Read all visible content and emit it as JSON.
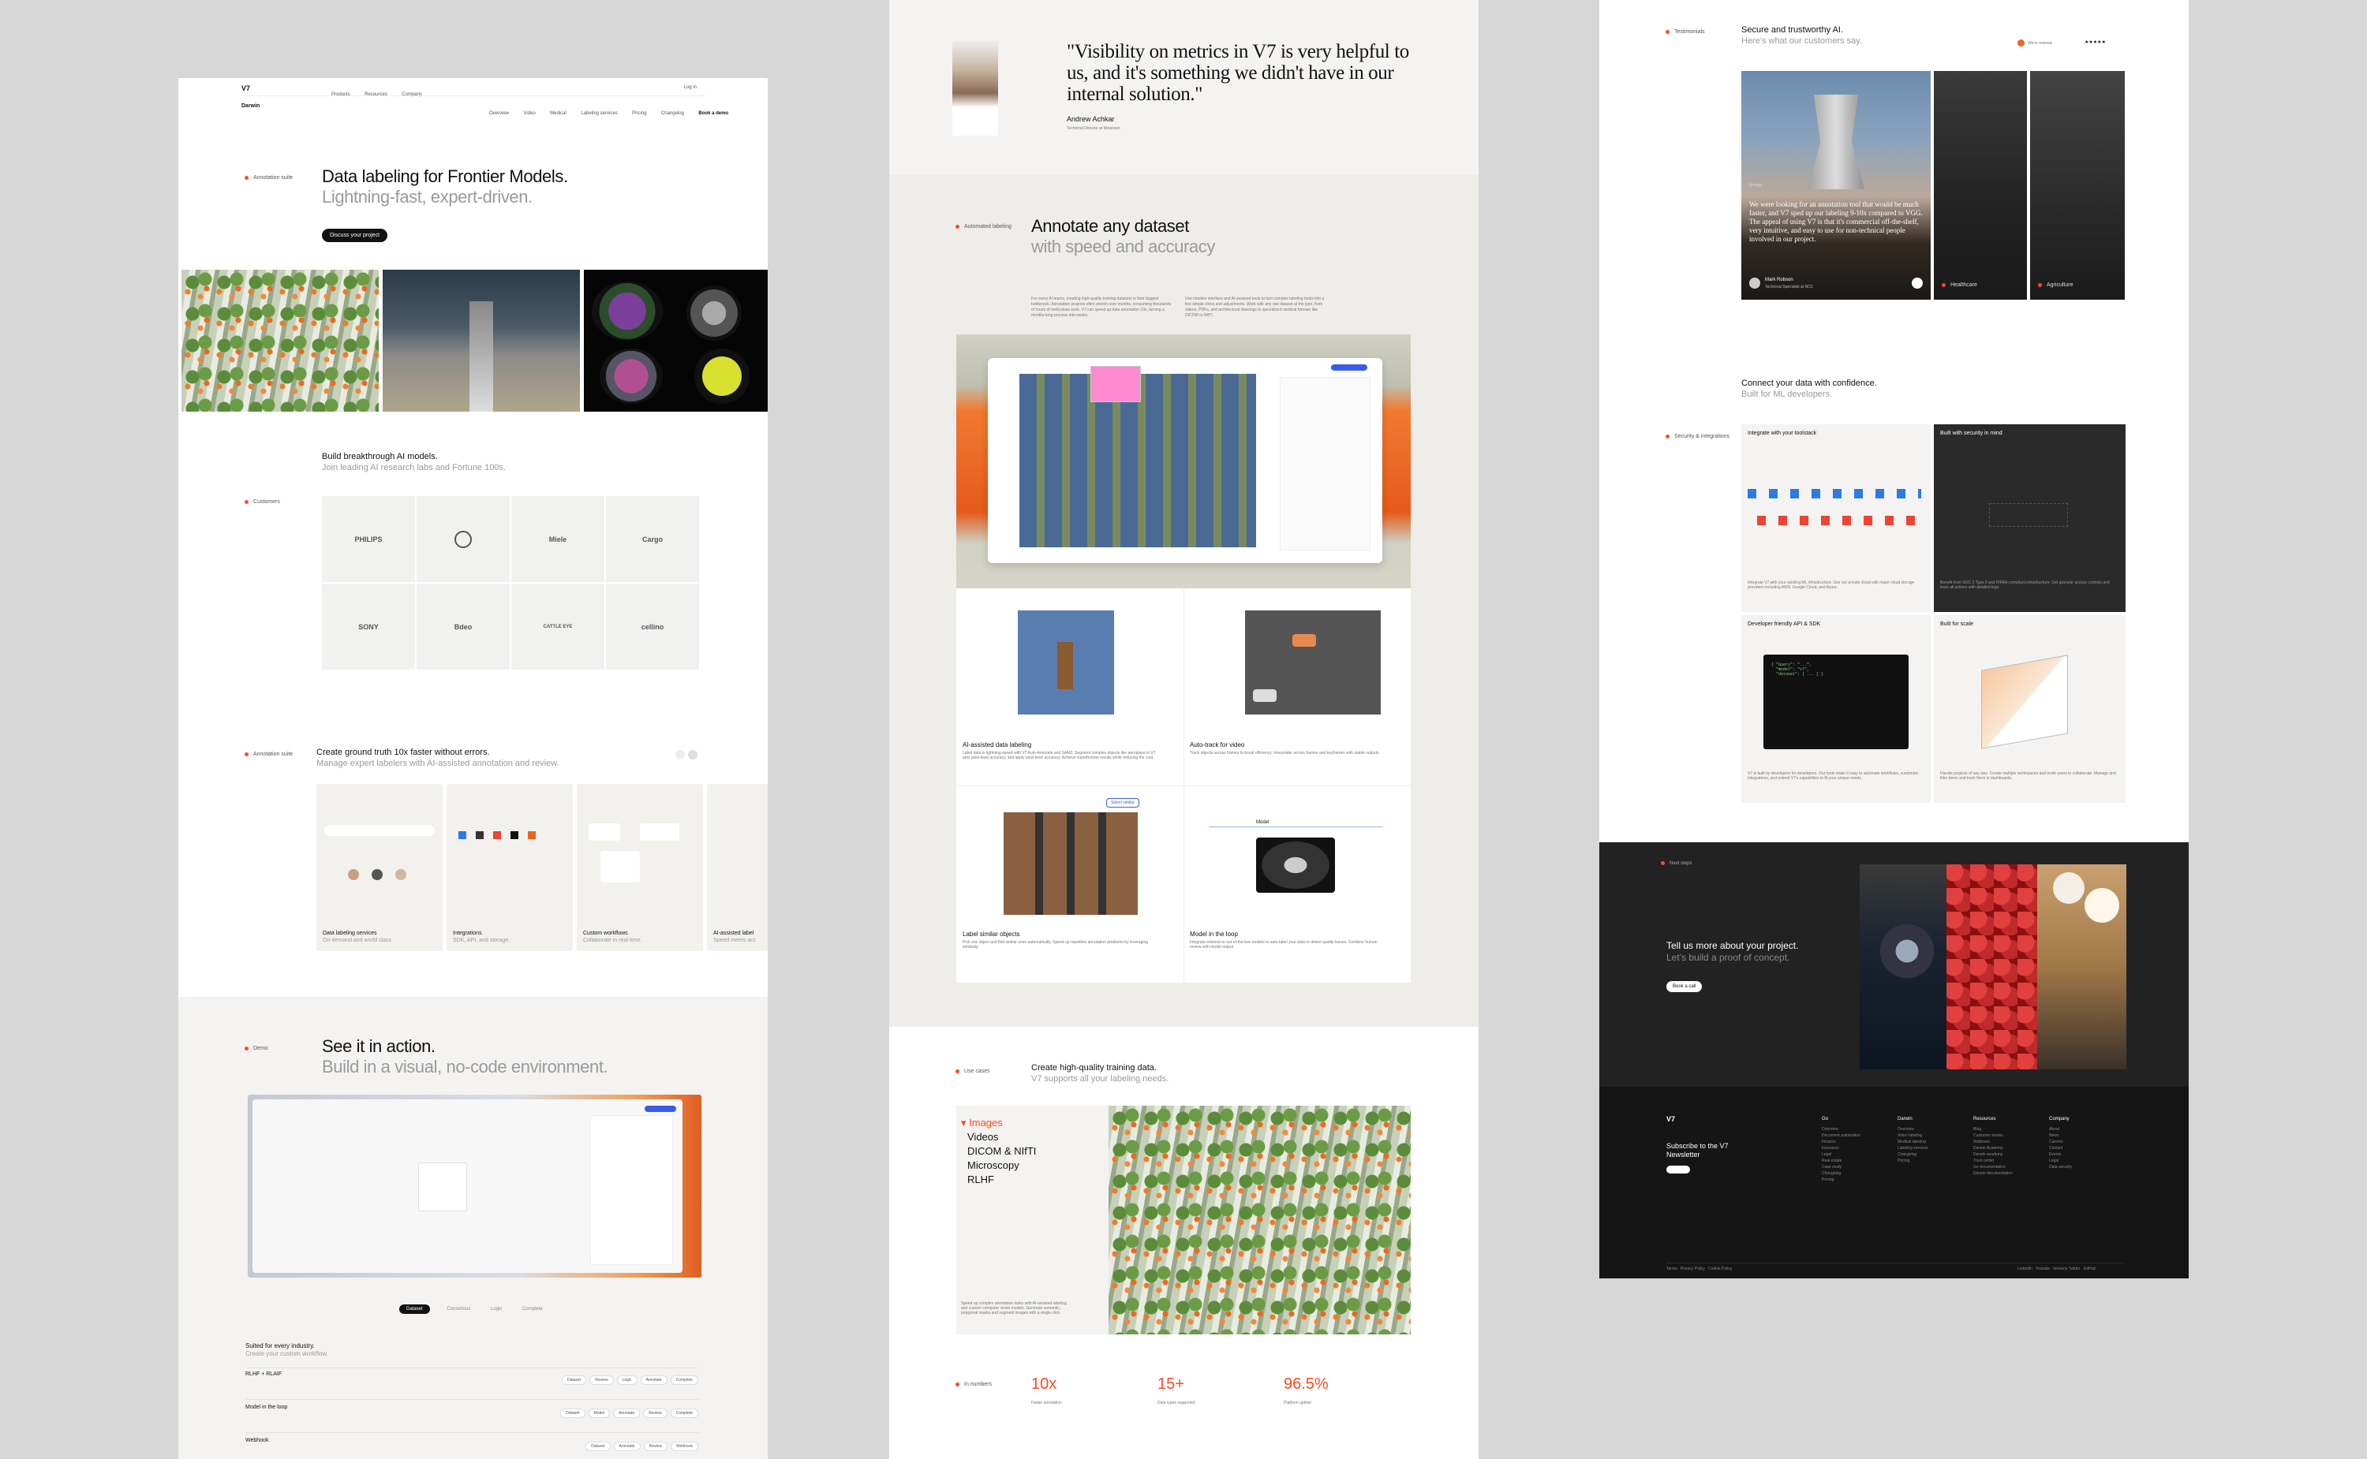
{
  "col1": {
    "logo": "V7",
    "nav": [
      "Products",
      "Resources",
      "Company"
    ],
    "login": "Log in",
    "subnav_brand": "Darwin",
    "subnav": [
      "Overview",
      "Video",
      "Medical",
      "Labeling services",
      "Pricing",
      "Changelog"
    ],
    "demo_button": "Book a demo",
    "section_label": "Annotation suite",
    "hero_title": "Data labeling for Frontier Models.",
    "hero_subtitle": "Lightning-fast, expert-driven.",
    "hero_cta": "Discuss your project",
    "customers_title": "Build breakthrough AI models.",
    "customers_subtitle": "Join leading AI research labs and Fortune 100s.",
    "customers_label": "Customers",
    "logos": [
      "PHILIPS",
      "",
      "Miele",
      "Cargo",
      "SONY",
      "Bdeo",
      "CATTLE EYE",
      "cellino"
    ],
    "annotation_label": "Annotation suite",
    "annotation_title": "Create ground truth 10x faster without errors.",
    "annotation_subtitle": "Manage expert labelers with AI-assisted annotation and review.",
    "feature_cards": [
      {
        "title": "Data labeling services",
        "subtitle": "On-demand and world class."
      },
      {
        "title": "Integrations",
        "subtitle": "SDK, API, and storage."
      },
      {
        "title": "Custom workflows",
        "subtitle": "Collaborate in real-time."
      },
      {
        "title": "AI-assisted label",
        "subtitle": "Speed meets acc"
      }
    ],
    "demo_label": "Demo",
    "demo_title": "See it in action.",
    "demo_subtitle": "Build in a visual, no-code environment.",
    "demo_tabs": [
      "Dataset",
      "Consensus",
      "Logic",
      "Complete"
    ],
    "industry_title": "Suited for every industry.",
    "industry_subtitle": "Create your custom workflow.",
    "workflows": [
      {
        "name": "RLHF + RLAIF",
        "steps": [
          "Dataset",
          "Review",
          "Logic",
          "Annotate",
          "Complete"
        ]
      },
      {
        "name": "Model in the loop",
        "steps": [
          "Dataset",
          "Model",
          "Annotate",
          "Review",
          "Complete"
        ]
      },
      {
        "name": "Webhook",
        "steps": [
          "Dataset",
          "Annotate",
          "Review",
          "Webhook"
        ]
      }
    ]
  },
  "col2": {
    "quote": "\"Visibility on metrics in V7 is very helpful to us, and it's something we didn't have in our internal solution.\"",
    "quote_author": "Andrew Achkar",
    "quote_role": "Technical Director at Miovision",
    "auto_label": "Automated labeling",
    "auto_title": "Annotate any dataset",
    "auto_subtitle": "with speed and accuracy",
    "auto_desc_left": "For many AI teams, creating high-quality training datasets is their biggest bottleneck. Annotation projects often stretch over months, consuming thousands of hours of meticulous work. V7 can speed up data annotation 10x, turning a months-long process into weeks.",
    "auto_desc_right": "Use intuitive interface and AI-assisted tools to turn complex labeling tasks into a few simple clicks and adjustments. Work with any raw dataset at the type, from videos, PDFs, and architectural drawings to specialized medical formats like DICOM or NIfTI.",
    "grid_cards": [
      {
        "title": "AI-assisted data labeling",
        "desc": "Label data in lightning speed with V7 Auto-Annotate and SAM2. Segment complex objects like aeroplane in V7 gets pixel-level accuracy, and apply pixel-level accuracy. Achieve superhuman results while reducing the cost."
      },
      {
        "title": "Auto-track for video",
        "desc": "Track objects across frames to boost efficiency. Interpolate across frames and keyframes with stable outputs."
      },
      {
        "title": "Label similar objects",
        "desc": "Pick one object and find similar ones automatically. Speed up repetitive annotation problems by leveraging similarity."
      },
      {
        "title": "Model in the loop",
        "desc": "Integrate external or out-of-the-box models to auto-label your data or detect quality issues. Combine human review with model output."
      }
    ],
    "model_label": "Model",
    "similar_btn": "Select similar",
    "use_label": "Use cases",
    "use_title": "Create high-quality training data.",
    "use_subtitle": "V7 supports all your labeling needs.",
    "use_tabs": [
      "Images",
      "Videos",
      "DICOM & NIfTI",
      "Microscopy",
      "RLHF"
    ],
    "use_desc": "Speed up complex annotation tasks with AI-assisted labeling and custom computer vision models. Generate semantic, polygonal masks and segment images with a single click.",
    "numbers_label": "In numbers",
    "stats": [
      {
        "value": "10x",
        "label": "Faster annotation"
      },
      {
        "value": "15+",
        "label": "Data types supported"
      },
      {
        "value": "96.5%",
        "label": "Platform uptime"
      }
    ]
  },
  "col3": {
    "testimonials_label": "Testimonials",
    "testimonials_title": "Secure and trustworthy AI.",
    "testimonials_subtitle": "Here's what our customers say.",
    "rating_text": "We're reviews",
    "testimonial_quote": "We were looking for an annotation tool that would be much faster, and V7 sped up our labeling 9-10x compared to VGG. The appeal of using V7 is that it's commercial off-the-shelf, very intuitive, and easy to use for non-technical people involved in our project.",
    "testimonial_author": "Mark Robson",
    "testimonial_role": "Technical Specialist at NCC",
    "testimonial_tag": "Energy",
    "side_cards": [
      "Healthcare",
      "Agriculture"
    ],
    "connect_title": "Connect your data with confidence.",
    "connect_subtitle": "Built for ML developers.",
    "security_label": "Security & integrations",
    "connect_cards": [
      {
        "title": "Integrate with your toolstack",
        "desc": "Integrate V7 with your existing ML infrastructure. Use our private cloud with major cloud storage providers including AWS, Google Cloud, and Azure."
      },
      {
        "title": "Built with security in mind",
        "desc": "Benefit from SOC 2 Type II and HIPAA compliant infrastructure. Get granular access controls and track all actions with detailed logs."
      },
      {
        "title": "Developer friendly API & SDK",
        "desc": "V7 is built by developers for developers. Our tools make it easy to automate workflows, customize integrations, and extend V7's capabilities to fit your unique needs."
      },
      {
        "title": "Built for scale",
        "desc": "Handle projects of any size. Create multiple workspaces and invite users to collaborate. Manage and filter items and track them in dashboards."
      }
    ],
    "cta_label": "Next steps",
    "cta_title": "Tell us more about your project.",
    "cta_subtitle": "Let's build a proof of concept.",
    "cta_button": "Book a call",
    "footer_logo": "V7",
    "newsletter": "Subscribe to the V7 Newsletter",
    "footer_cols": [
      {
        "title": "Go",
        "items": [
          "Overview",
          "Document automation",
          "Finance",
          "Insurance",
          "Legal",
          "Real estate",
          "Case study",
          "Changelog",
          "Pricing"
        ]
      },
      {
        "title": "Darwin",
        "items": [
          "Overview",
          "Video labeling",
          "Medical labeling",
          "Labeling services",
          "Changelog",
          "Pricing"
        ]
      },
      {
        "title": "Resources",
        "items": [
          "Blog",
          "Customer stories",
          "Webinars",
          "Darwin Academy",
          "Darwin academy",
          "Trust center",
          "Go documentation",
          "Darwin documentation"
        ]
      },
      {
        "title": "Company",
        "items": [
          "About",
          "News",
          "Careers",
          "Contact",
          "Events",
          "Legal",
          "Data security"
        ]
      }
    ],
    "footer_legal": [
      "Terms",
      "Privacy Policy",
      "Cookie Policy"
    ],
    "footer_social": [
      "LinkedIn",
      "Youtube",
      "formerly Twitter",
      "GitHub"
    ]
  },
  "colors": {
    "accent": "#ff4b1f",
    "dark": "#1a1a1a",
    "bg": "#d7d7d7"
  }
}
